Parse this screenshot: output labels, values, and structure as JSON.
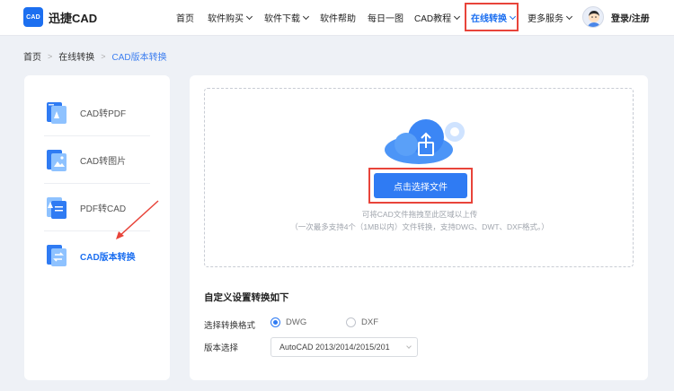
{
  "header": {
    "logo_mark": "CAD",
    "logo_text": "迅捷CAD",
    "nav": [
      {
        "label": "首页",
        "has_dropdown": false,
        "active": false
      },
      {
        "label": "软件购买",
        "has_dropdown": true,
        "active": false
      },
      {
        "label": "软件下载",
        "has_dropdown": true,
        "active": false
      },
      {
        "label": "软件帮助",
        "has_dropdown": false,
        "active": false
      },
      {
        "label": "每日一图",
        "has_dropdown": false,
        "active": false
      },
      {
        "label": "CAD教程",
        "has_dropdown": true,
        "active": false
      },
      {
        "label": "在线转换",
        "has_dropdown": true,
        "active": true
      },
      {
        "label": "更多服务",
        "has_dropdown": true,
        "active": false
      }
    ],
    "login_label": "登录/注册"
  },
  "breadcrumb": {
    "items": [
      "首页",
      "在线转换",
      "CAD版本转换"
    ],
    "separator": ">"
  },
  "sidebar": {
    "items": [
      {
        "label": "CAD转PDF",
        "icon": "cad-to-pdf-icon",
        "selected": false
      },
      {
        "label": "CAD转图片",
        "icon": "cad-to-image-icon",
        "selected": false
      },
      {
        "label": "PDF转CAD",
        "icon": "pdf-to-cad-icon",
        "selected": false
      },
      {
        "label": "CAD版本转换",
        "icon": "cad-version-convert-icon",
        "selected": true
      }
    ]
  },
  "upload": {
    "button_label": "点击选择文件",
    "hint_line1": "可将CAD文件拖拽至此区域以上传",
    "hint_line2": "（一次最多支持4个（1MB以内）文件转换，支持DWG、DWT、DXF格式。）"
  },
  "settings": {
    "title": "自定义设置转换如下",
    "format_label": "选择转换格式",
    "format_options": [
      {
        "label": "DWG",
        "checked": true
      },
      {
        "label": "DXF",
        "checked": false
      }
    ],
    "version_label": "版本选择",
    "version_value": "AutoCAD 2013/2014/2015/201"
  },
  "colors": {
    "accent": "#1c6ff0",
    "button": "#2f7bf3",
    "highlight_border": "#e8443a",
    "background": "#eef1f6"
  }
}
